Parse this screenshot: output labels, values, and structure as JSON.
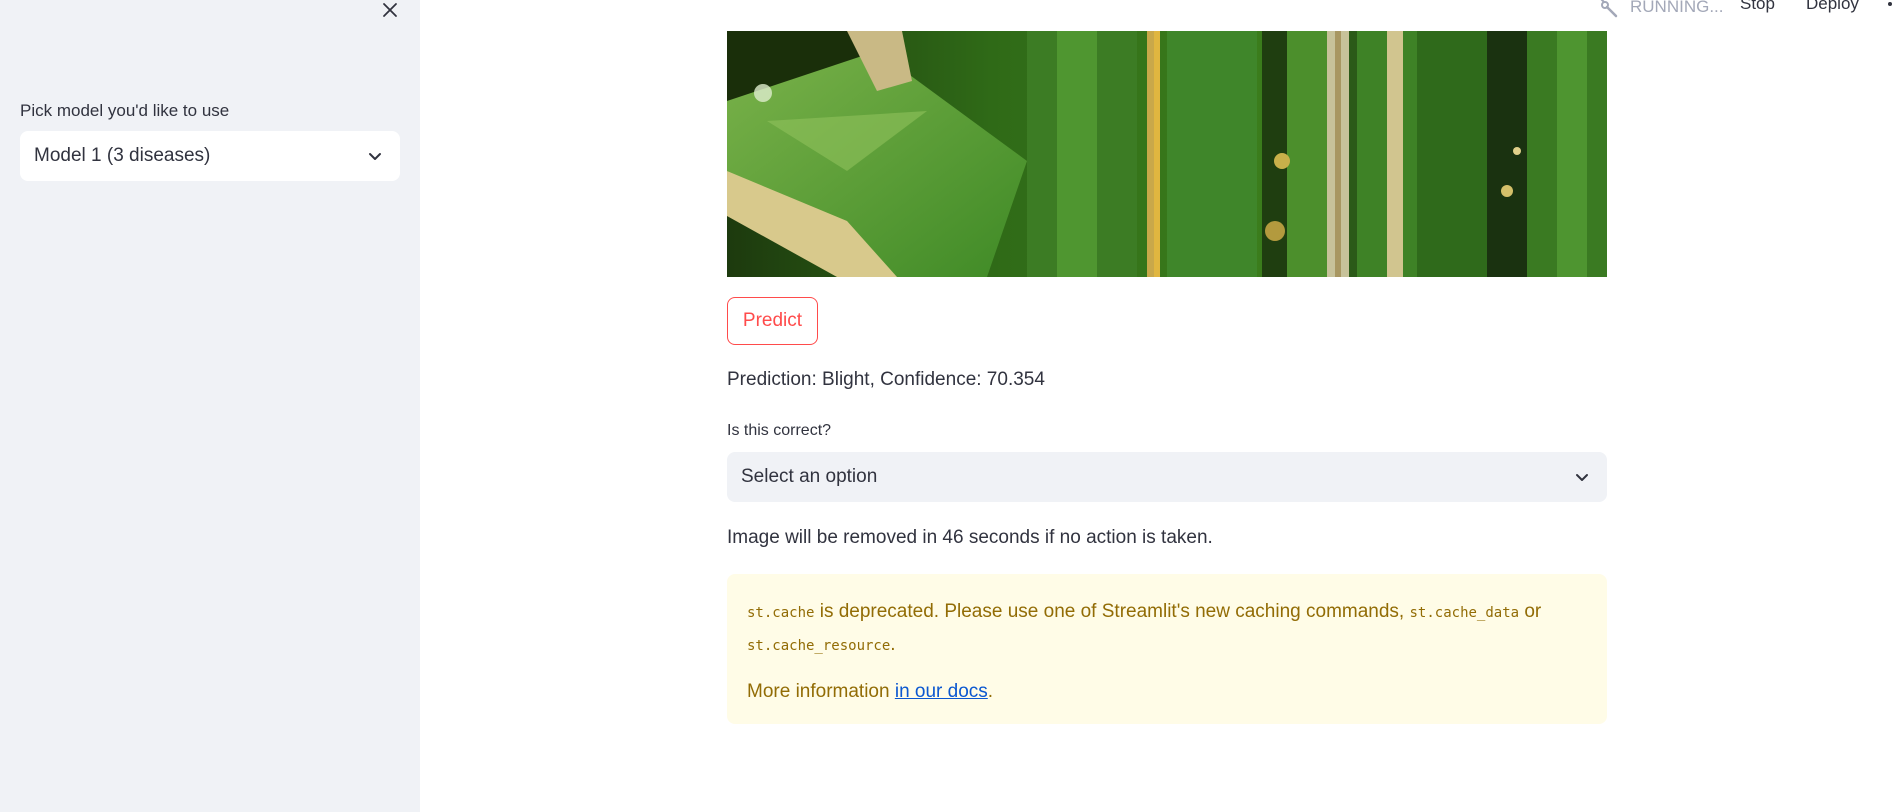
{
  "sidebar": {
    "model_label": "Pick model you'd like to use",
    "model_value": "Model 1 (3 diseases)"
  },
  "header": {
    "status": "RUNNING...",
    "stop_label": "Stop",
    "deploy_label": "Deploy"
  },
  "main": {
    "predict_label": "Predict",
    "prediction_text": "Prediction: Blight, Confidence: 70.354",
    "correct_label": "Is this correct?",
    "correct_placeholder": "Select an option",
    "countdown_text": "Image will be removed in 46 seconds if no action is taken."
  },
  "warning": {
    "code_cache": "st.cache",
    "text1": " is deprecated. Please use one of Streamlit's new caching commands, ",
    "code_cache_data": "st.cache_data",
    "text_or": " or ",
    "code_cache_resource": "st.cache_resource",
    "text_period": ".",
    "more_info": "More information ",
    "link_text": "in our docs",
    "end_period": "."
  },
  "colors": {
    "accent": "#ff4b4b",
    "sidebar_bg": "#f0f2f6",
    "warning_bg": "#fffce7",
    "warning_text": "#926c05",
    "link": "#0b57d0"
  },
  "icons": {
    "close": "close-icon",
    "chevron": "chevron-down-icon",
    "running": "running-icon",
    "menu": "more-vertical-icon"
  }
}
